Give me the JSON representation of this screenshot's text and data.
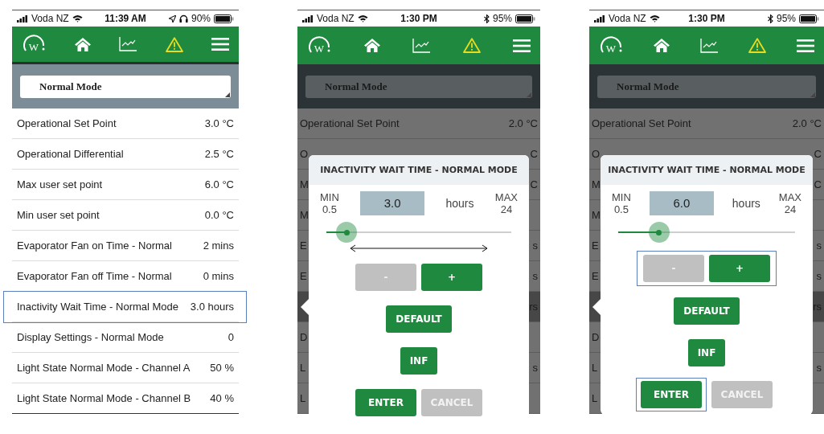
{
  "phones": [
    {
      "kind": "list",
      "status": {
        "carrier": "Voda NZ",
        "time": "11:39 AM",
        "battery": "90%"
      },
      "logo": "W",
      "mode": "Normal Mode",
      "rows": [
        {
          "label": "Operational Set Point",
          "value": "3.0 °C",
          "highlighted": false
        },
        {
          "label": "Operational Differential",
          "value": "2.5 °C",
          "highlighted": false
        },
        {
          "label": "Max user set point",
          "value": "6.0 °C",
          "highlighted": false
        },
        {
          "label": "Min user set point",
          "value": "0.0 °C",
          "highlighted": false
        },
        {
          "label": "Evaporator Fan on Time - Normal",
          "value": "2 mins",
          "highlighted": false
        },
        {
          "label": "Evaporator Fan off Time - Normal",
          "value": "0 mins",
          "highlighted": false
        },
        {
          "label": "Inactivity Wait Time - Normal Mode",
          "value": "3.0 hours",
          "highlighted": true
        },
        {
          "label": "Display Settings - Normal Mode",
          "value": "0",
          "highlighted": false
        },
        {
          "label": "Light State Normal Mode - Channel A",
          "value": "50 %",
          "highlighted": false
        },
        {
          "label": "Light State Normal Mode - Channel B",
          "value": "40 %",
          "highlighted": false
        }
      ]
    },
    {
      "kind": "dialog",
      "status": {
        "carrier": "Voda NZ",
        "time": "1:30 PM",
        "battery": "95%"
      },
      "logo": "W",
      "mode": "Normal Mode",
      "rows": [
        {
          "label": "Operational Set Point",
          "value": "2.0 °C",
          "selected": false
        },
        {
          "label": "O",
          "value": "C",
          "selected": false
        },
        {
          "label": "M",
          "value": "C",
          "selected": false
        },
        {
          "label": "M",
          "selected": false
        },
        {
          "label": "E",
          "value": "s",
          "selected": false
        },
        {
          "label": "E",
          "value": "s",
          "selected": false
        },
        {
          "value": "rs",
          "selected": true
        },
        {
          "label": "D",
          "selected": false
        },
        {
          "label": "L",
          "value": "s",
          "selected": false
        },
        {
          "label": "L",
          "selected": false
        }
      ],
      "dialog": {
        "title": "INACTIVITY WAIT TIME - NORMAL MODE",
        "min_label": "MIN",
        "min_value": "0.5",
        "value": "3.0",
        "unit": "hours",
        "max_label": "MAX",
        "max_value": "24",
        "slider": {
          "level": 0.11,
          "arrow": true
        },
        "button_rows": [
          {
            "highlighted": false,
            "buttons": [
              {
                "label": "-",
                "kind": "secondary",
                "highlighted": false
              },
              {
                "label": "+",
                "kind": "primary",
                "highlighted": false
              }
            ]
          },
          {
            "highlighted": false,
            "buttons": [
              {
                "label": "DEFAULT",
                "kind": "primary",
                "highlighted": false
              }
            ]
          },
          {
            "highlighted": false,
            "buttons": [
              {
                "label": "INF",
                "kind": "primary",
                "highlighted": false
              }
            ]
          },
          {
            "highlighted": false,
            "buttons": [
              {
                "label": "ENTER",
                "kind": "primary",
                "highlighted": false
              },
              {
                "label": "CANCEL",
                "kind": "secondary",
                "highlighted": false
              }
            ]
          }
        ]
      }
    },
    {
      "kind": "dialog",
      "status": {
        "carrier": "Voda NZ",
        "time": "1:30 PM",
        "battery": "95%"
      },
      "logo": "W",
      "mode": "Normal Mode",
      "rows": [
        {
          "label": "Operational Set Point",
          "value": "2.0 °C",
          "selected": false
        },
        {
          "label": "O",
          "value": "C",
          "selected": false
        },
        {
          "label": "M",
          "value": "C",
          "selected": false
        },
        {
          "label": "M",
          "selected": false
        },
        {
          "label": "E",
          "value": "s",
          "selected": false
        },
        {
          "label": "E",
          "value": "s",
          "selected": false
        },
        {
          "value": "rs",
          "selected": true
        },
        {
          "label": "D",
          "selected": false
        },
        {
          "label": "L",
          "value": "s",
          "selected": false
        },
        {
          "label": "L",
          "selected": false
        }
      ],
      "dialog": {
        "title": "INACTIVITY WAIT TIME - NORMAL MODE",
        "min_label": "MIN",
        "min_value": "0.5",
        "value": "6.0",
        "unit": "hours",
        "max_label": "MAX",
        "max_value": "24",
        "slider": {
          "level": 0.23,
          "arrow": false
        },
        "button_rows": [
          {
            "highlighted": true,
            "buttons": [
              {
                "label": "-",
                "kind": "secondary",
                "highlighted": false
              },
              {
                "label": "+",
                "kind": "primary",
                "highlighted": false
              }
            ]
          },
          {
            "highlighted": false,
            "buttons": [
              {
                "label": "DEFAULT",
                "kind": "primary",
                "highlighted": false
              }
            ]
          },
          {
            "highlighted": false,
            "buttons": [
              {
                "label": "INF",
                "kind": "primary",
                "highlighted": false
              }
            ]
          },
          {
            "highlighted": false,
            "buttons": [
              {
                "label": "ENTER",
                "kind": "primary",
                "highlighted": true
              },
              {
                "label": "CANCEL",
                "kind": "secondary",
                "highlighted": false
              }
            ]
          }
        ]
      }
    }
  ]
}
